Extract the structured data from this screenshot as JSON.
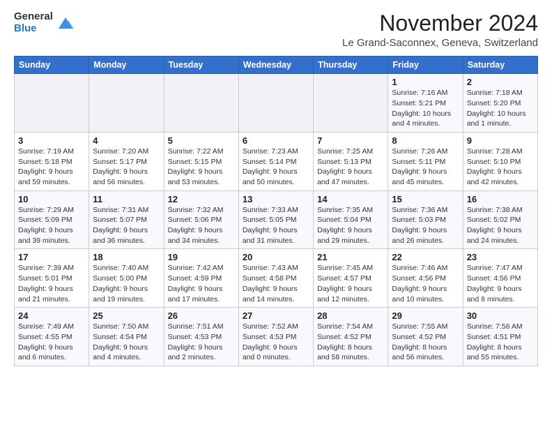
{
  "logo": {
    "general": "General",
    "blue": "Blue"
  },
  "title": "November 2024",
  "location": "Le Grand-Saconnex, Geneva, Switzerland",
  "weekdays": [
    "Sunday",
    "Monday",
    "Tuesday",
    "Wednesday",
    "Thursday",
    "Friday",
    "Saturday"
  ],
  "weeks": [
    [
      {
        "day": "",
        "sunrise": "",
        "sunset": "",
        "daylight": ""
      },
      {
        "day": "",
        "sunrise": "",
        "sunset": "",
        "daylight": ""
      },
      {
        "day": "",
        "sunrise": "",
        "sunset": "",
        "daylight": ""
      },
      {
        "day": "",
        "sunrise": "",
        "sunset": "",
        "daylight": ""
      },
      {
        "day": "",
        "sunrise": "",
        "sunset": "",
        "daylight": ""
      },
      {
        "day": "1",
        "sunrise": "Sunrise: 7:16 AM",
        "sunset": "Sunset: 5:21 PM",
        "daylight": "Daylight: 10 hours and 4 minutes."
      },
      {
        "day": "2",
        "sunrise": "Sunrise: 7:18 AM",
        "sunset": "Sunset: 5:20 PM",
        "daylight": "Daylight: 10 hours and 1 minute."
      }
    ],
    [
      {
        "day": "3",
        "sunrise": "Sunrise: 7:19 AM",
        "sunset": "Sunset: 5:18 PM",
        "daylight": "Daylight: 9 hours and 59 minutes."
      },
      {
        "day": "4",
        "sunrise": "Sunrise: 7:20 AM",
        "sunset": "Sunset: 5:17 PM",
        "daylight": "Daylight: 9 hours and 56 minutes."
      },
      {
        "day": "5",
        "sunrise": "Sunrise: 7:22 AM",
        "sunset": "Sunset: 5:15 PM",
        "daylight": "Daylight: 9 hours and 53 minutes."
      },
      {
        "day": "6",
        "sunrise": "Sunrise: 7:23 AM",
        "sunset": "Sunset: 5:14 PM",
        "daylight": "Daylight: 9 hours and 50 minutes."
      },
      {
        "day": "7",
        "sunrise": "Sunrise: 7:25 AM",
        "sunset": "Sunset: 5:13 PM",
        "daylight": "Daylight: 9 hours and 47 minutes."
      },
      {
        "day": "8",
        "sunrise": "Sunrise: 7:26 AM",
        "sunset": "Sunset: 5:11 PM",
        "daylight": "Daylight: 9 hours and 45 minutes."
      },
      {
        "day": "9",
        "sunrise": "Sunrise: 7:28 AM",
        "sunset": "Sunset: 5:10 PM",
        "daylight": "Daylight: 9 hours and 42 minutes."
      }
    ],
    [
      {
        "day": "10",
        "sunrise": "Sunrise: 7:29 AM",
        "sunset": "Sunset: 5:09 PM",
        "daylight": "Daylight: 9 hours and 39 minutes."
      },
      {
        "day": "11",
        "sunrise": "Sunrise: 7:31 AM",
        "sunset": "Sunset: 5:07 PM",
        "daylight": "Daylight: 9 hours and 36 minutes."
      },
      {
        "day": "12",
        "sunrise": "Sunrise: 7:32 AM",
        "sunset": "Sunset: 5:06 PM",
        "daylight": "Daylight: 9 hours and 34 minutes."
      },
      {
        "day": "13",
        "sunrise": "Sunrise: 7:33 AM",
        "sunset": "Sunset: 5:05 PM",
        "daylight": "Daylight: 9 hours and 31 minutes."
      },
      {
        "day": "14",
        "sunrise": "Sunrise: 7:35 AM",
        "sunset": "Sunset: 5:04 PM",
        "daylight": "Daylight: 9 hours and 29 minutes."
      },
      {
        "day": "15",
        "sunrise": "Sunrise: 7:36 AM",
        "sunset": "Sunset: 5:03 PM",
        "daylight": "Daylight: 9 hours and 26 minutes."
      },
      {
        "day": "16",
        "sunrise": "Sunrise: 7:38 AM",
        "sunset": "Sunset: 5:02 PM",
        "daylight": "Daylight: 9 hours and 24 minutes."
      }
    ],
    [
      {
        "day": "17",
        "sunrise": "Sunrise: 7:39 AM",
        "sunset": "Sunset: 5:01 PM",
        "daylight": "Daylight: 9 hours and 21 minutes."
      },
      {
        "day": "18",
        "sunrise": "Sunrise: 7:40 AM",
        "sunset": "Sunset: 5:00 PM",
        "daylight": "Daylight: 9 hours and 19 minutes."
      },
      {
        "day": "19",
        "sunrise": "Sunrise: 7:42 AM",
        "sunset": "Sunset: 4:59 PM",
        "daylight": "Daylight: 9 hours and 17 minutes."
      },
      {
        "day": "20",
        "sunrise": "Sunrise: 7:43 AM",
        "sunset": "Sunset: 4:58 PM",
        "daylight": "Daylight: 9 hours and 14 minutes."
      },
      {
        "day": "21",
        "sunrise": "Sunrise: 7:45 AM",
        "sunset": "Sunset: 4:57 PM",
        "daylight": "Daylight: 9 hours and 12 minutes."
      },
      {
        "day": "22",
        "sunrise": "Sunrise: 7:46 AM",
        "sunset": "Sunset: 4:56 PM",
        "daylight": "Daylight: 9 hours and 10 minutes."
      },
      {
        "day": "23",
        "sunrise": "Sunrise: 7:47 AM",
        "sunset": "Sunset: 4:56 PM",
        "daylight": "Daylight: 9 hours and 8 minutes."
      }
    ],
    [
      {
        "day": "24",
        "sunrise": "Sunrise: 7:49 AM",
        "sunset": "Sunset: 4:55 PM",
        "daylight": "Daylight: 9 hours and 6 minutes."
      },
      {
        "day": "25",
        "sunrise": "Sunrise: 7:50 AM",
        "sunset": "Sunset: 4:54 PM",
        "daylight": "Daylight: 9 hours and 4 minutes."
      },
      {
        "day": "26",
        "sunrise": "Sunrise: 7:51 AM",
        "sunset": "Sunset: 4:53 PM",
        "daylight": "Daylight: 9 hours and 2 minutes."
      },
      {
        "day": "27",
        "sunrise": "Sunrise: 7:52 AM",
        "sunset": "Sunset: 4:53 PM",
        "daylight": "Daylight: 9 hours and 0 minutes."
      },
      {
        "day": "28",
        "sunrise": "Sunrise: 7:54 AM",
        "sunset": "Sunset: 4:52 PM",
        "daylight": "Daylight: 8 hours and 58 minutes."
      },
      {
        "day": "29",
        "sunrise": "Sunrise: 7:55 AM",
        "sunset": "Sunset: 4:52 PM",
        "daylight": "Daylight: 8 hours and 56 minutes."
      },
      {
        "day": "30",
        "sunrise": "Sunrise: 7:56 AM",
        "sunset": "Sunset: 4:51 PM",
        "daylight": "Daylight: 8 hours and 55 minutes."
      }
    ]
  ]
}
